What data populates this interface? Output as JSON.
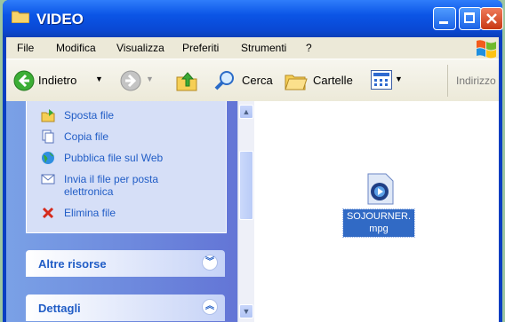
{
  "window": {
    "title": "VIDEO",
    "buttons": {
      "minimize_icon": "minimize-icon",
      "maximize_icon": "maximize-icon",
      "close_icon": "close-icon"
    }
  },
  "menu": [
    "File",
    "Modifica",
    "Visualizza",
    "Preferiti",
    "Strumenti",
    "?"
  ],
  "toolbar": {
    "back": "Indietro",
    "search": "Cerca",
    "folders": "Cartelle",
    "address": "Indirizzo"
  },
  "tasks": [
    {
      "label": "Sposta file",
      "icon": "move-file-icon"
    },
    {
      "label": "Copia file",
      "icon": "copy-file-icon"
    },
    {
      "label": "Pubblica file sul Web",
      "icon": "globe-icon"
    },
    {
      "label": "Invia il file per posta",
      "label2": "elettronica",
      "icon": "email-icon"
    },
    {
      "label": "Elimina file",
      "icon": "delete-x-icon"
    }
  ],
  "sections": {
    "other": "Altre risorse",
    "details": "Dettagli"
  },
  "file": {
    "name_line1": "SOJOURNER.",
    "name_line2": "mpg",
    "icon": "video-file-icon"
  },
  "colors": {
    "titlebar": "#0b55e6",
    "taskpane": "#6f8fe0",
    "link": "#215dc6",
    "selection": "#316ac5"
  }
}
